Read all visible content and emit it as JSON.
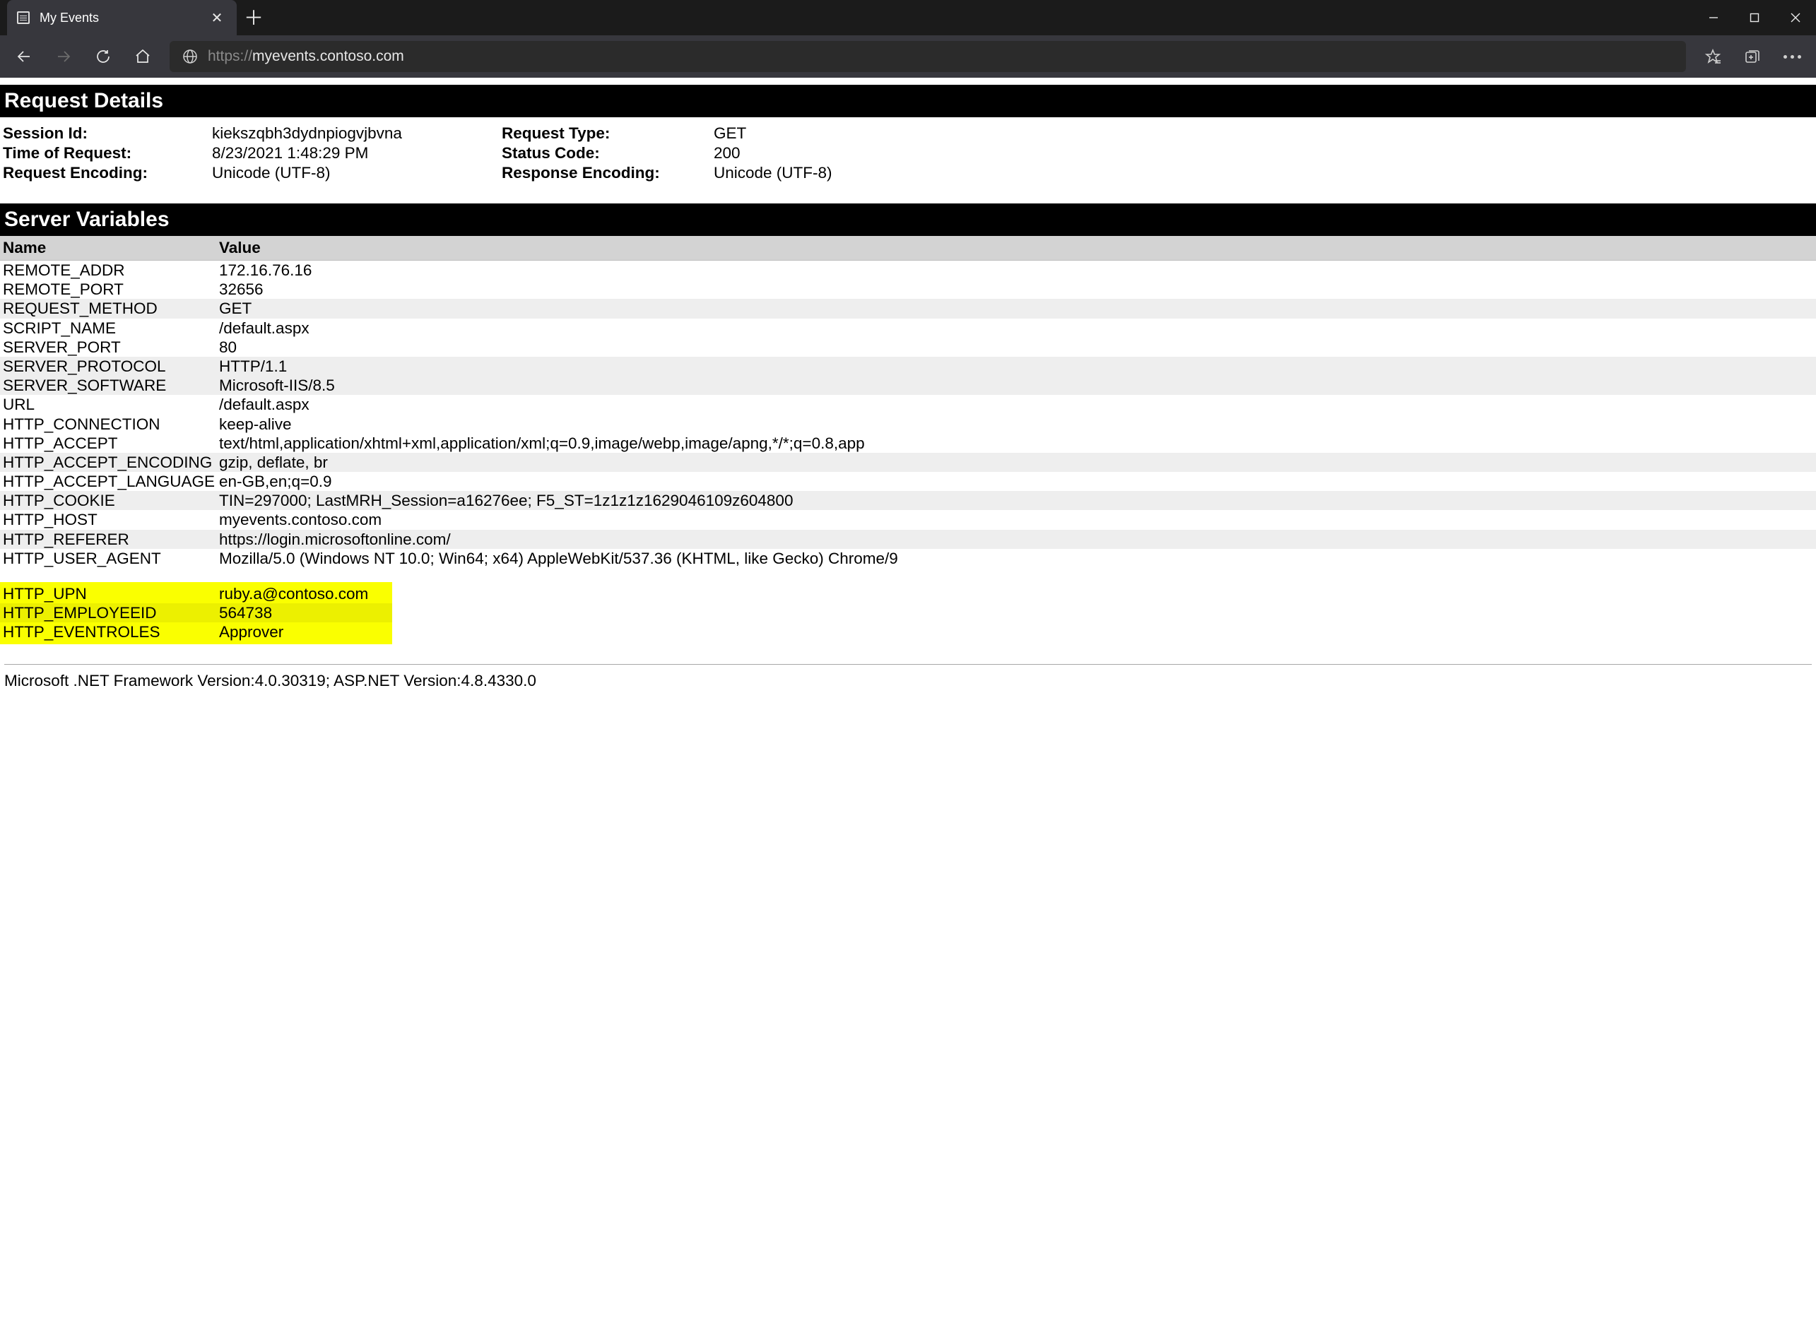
{
  "browser": {
    "tab_title": "My Events",
    "url_protocol": "https://",
    "url_host": "myevents.contoso.com"
  },
  "request_details": {
    "title": "Request Details",
    "labels": {
      "session_id": "Session Id:",
      "request_type": "Request Type:",
      "time": "Time of Request:",
      "status": "Status Code:",
      "req_enc": "Request Encoding:",
      "resp_enc": "Response Encoding:"
    },
    "session_id": "kiekszqbh3dydnpiogvjbvna",
    "request_type": "GET",
    "time_of_request": "8/23/2021 1:48:29 PM",
    "status_code": "200",
    "request_encoding": "Unicode (UTF-8)",
    "response_encoding": "Unicode (UTF-8)"
  },
  "server_vars": {
    "title": "Server Variables",
    "col_name": "Name",
    "col_value": "Value",
    "rows": [
      {
        "name": "REMOTE_ADDR",
        "value": "172.16.76.16"
      },
      {
        "name": "REMOTE_PORT",
        "value": "32656"
      },
      {
        "name": "REQUEST_METHOD",
        "value": "GET"
      },
      {
        "name": "SCRIPT_NAME",
        "value": "/default.aspx"
      },
      {
        "name": "SERVER_PORT",
        "value": "80"
      },
      {
        "name": "SERVER_PROTOCOL",
        "value": "HTTP/1.1"
      },
      {
        "name": "SERVER_SOFTWARE",
        "value": "Microsoft-IIS/8.5"
      },
      {
        "name": "URL",
        "value": "/default.aspx"
      },
      {
        "name": "HTTP_CONNECTION",
        "value": "keep-alive"
      },
      {
        "name": "HTTP_ACCEPT",
        "value": "text/html,application/xhtml+xml,application/xml;q=0.9,image/webp,image/apng,*/*;q=0.8,app"
      },
      {
        "name": "HTTP_ACCEPT_ENCODING",
        "value": "gzip, deflate, br"
      },
      {
        "name": "HTTP_ACCEPT_LANGUAGE",
        "value": "en-GB,en;q=0.9"
      },
      {
        "name": "HTTP_COOKIE",
        "value": "TIN=297000; LastMRH_Session=a16276ee; F5_ST=1z1z1z1629046109z604800"
      },
      {
        "name": "HTTP_HOST",
        "value": "myevents.contoso.com"
      },
      {
        "name": "HTTP_REFERER",
        "value": "https://login.microsoftonline.com/"
      },
      {
        "name": "HTTP_USER_AGENT",
        "value": "Mozilla/5.0 (Windows NT 10.0; Win64; x64) AppleWebKit/537.36 (KHTML, like Gecko) Chrome/9"
      }
    ],
    "highlighted": [
      {
        "name": "HTTP_UPN",
        "value": "ruby.a@contoso.com"
      },
      {
        "name": "HTTP_EMPLOYEEID",
        "value": "564738"
      },
      {
        "name": "HTTP_EVENTROLES",
        "value": "Approver"
      }
    ]
  },
  "footer": "Microsoft .NET Framework Version:4.0.30319; ASP.NET Version:4.8.4330.0"
}
